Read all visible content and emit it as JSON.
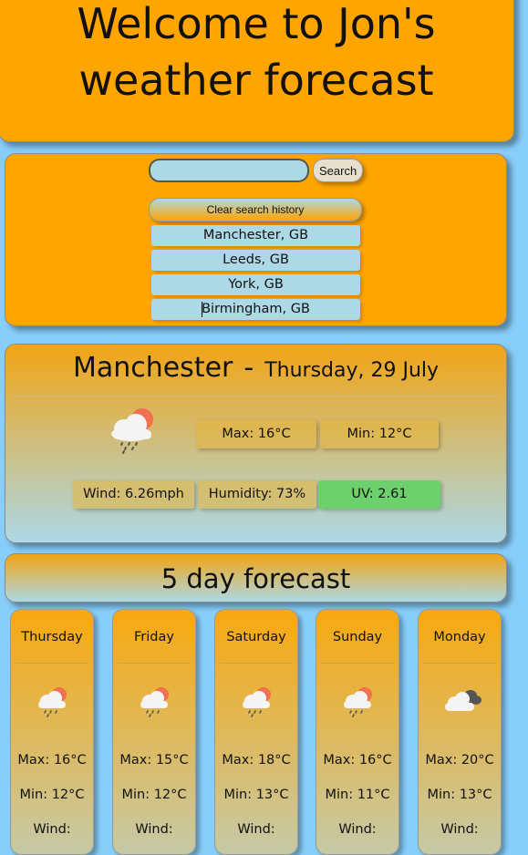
{
  "header": {
    "title": "Welcome to Jon's weather forecast"
  },
  "search": {
    "placeholder": "",
    "button_label": "Search",
    "clear_label": "Clear search history"
  },
  "history": [
    "Manchester, GB",
    "Leeds, GB",
    "York, GB",
    "Birmingham, GB"
  ],
  "current": {
    "city": "Manchester",
    "separator": "-",
    "date": "Thursday, 29 July",
    "icon": "rain-cloud-sun-icon",
    "max": "Max: 16°C",
    "min": "Min: 12°C",
    "wind": "Wind: 6.26mph",
    "humidity": "Humidity: 73%",
    "uv": "UV: 2.61",
    "uv_color": "#6cd16c"
  },
  "forecast": {
    "title": "5 day forecast",
    "days": [
      {
        "day": "Thursday",
        "icon": "rain-cloud-sun-icon",
        "max": "Max: 16°C",
        "min": "Min: 12°C",
        "wind": "Wind:"
      },
      {
        "day": "Friday",
        "icon": "rain-cloud-sun-icon",
        "max": "Max: 15°C",
        "min": "Min: 12°C",
        "wind": "Wind:"
      },
      {
        "day": "Saturday",
        "icon": "rain-cloud-sun-icon",
        "max": "Max: 18°C",
        "min": "Min: 13°C",
        "wind": "Wind:"
      },
      {
        "day": "Sunday",
        "icon": "rain-cloud-sun-icon",
        "max": "Max: 16°C",
        "min": "Min: 11°C",
        "wind": "Wind:"
      },
      {
        "day": "Monday",
        "icon": "cloudy-icon",
        "max": "Max: 20°C",
        "min": "Min: 13°C",
        "wind": "Wind:"
      }
    ]
  },
  "colors": {
    "background": "#87cefa",
    "panel": "#ffa500",
    "input": "#add8e6"
  }
}
